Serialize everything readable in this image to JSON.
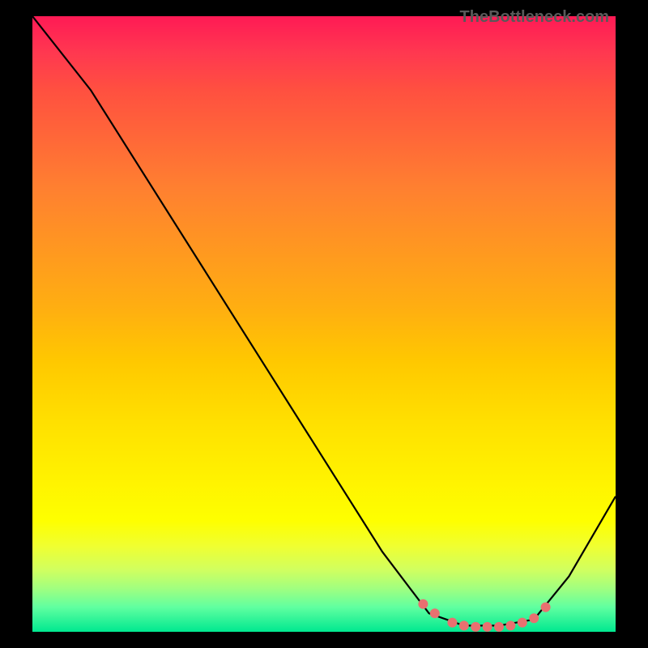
{
  "watermark": "TheBottleneck.com",
  "chart_data": {
    "type": "line",
    "title": "",
    "xlabel": "",
    "ylabel": "",
    "xlim": [
      0,
      100
    ],
    "ylim": [
      0,
      100
    ],
    "curve": {
      "name": "bottleneck-curve",
      "color": "#000000",
      "points": [
        {
          "x": 0,
          "y": 100
        },
        {
          "x": 10,
          "y": 88
        },
        {
          "x": 20,
          "y": 73
        },
        {
          "x": 30,
          "y": 58
        },
        {
          "x": 40,
          "y": 43
        },
        {
          "x": 50,
          "y": 28
        },
        {
          "x": 60,
          "y": 13
        },
        {
          "x": 68,
          "y": 3
        },
        {
          "x": 74,
          "y": 1
        },
        {
          "x": 80,
          "y": 1
        },
        {
          "x": 86,
          "y": 2
        },
        {
          "x": 92,
          "y": 9
        },
        {
          "x": 100,
          "y": 22
        }
      ]
    },
    "highlight_dots": {
      "name": "optimal-range",
      "color": "#e87070",
      "points": [
        {
          "x": 67,
          "y": 4.5
        },
        {
          "x": 69,
          "y": 3
        },
        {
          "x": 72,
          "y": 1.5
        },
        {
          "x": 74,
          "y": 1
        },
        {
          "x": 76,
          "y": 0.8
        },
        {
          "x": 78,
          "y": 0.8
        },
        {
          "x": 80,
          "y": 0.8
        },
        {
          "x": 82,
          "y": 1
        },
        {
          "x": 84,
          "y": 1.5
        },
        {
          "x": 86,
          "y": 2.2
        },
        {
          "x": 88,
          "y": 4
        }
      ]
    }
  }
}
